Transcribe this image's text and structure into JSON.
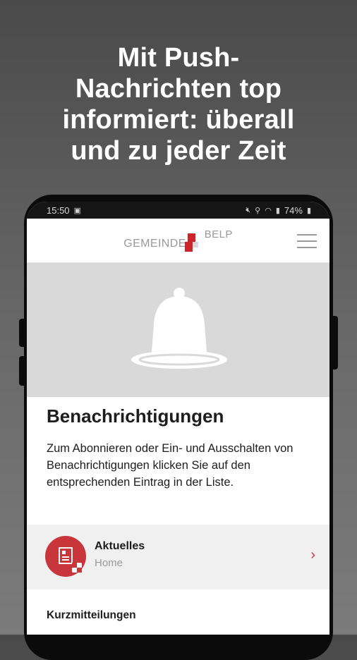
{
  "promo": {
    "line1": "Mit Push-",
    "line2": "Nachrichten top",
    "line3": "informiert: überall",
    "line4": "und zu jeder Zeit"
  },
  "statusbar": {
    "time": "15:50",
    "battery": "74%"
  },
  "app": {
    "logo_left": "GEMEINDE",
    "logo_right": "BELP"
  },
  "page": {
    "title": "Benachrichtigungen",
    "description": "Zum Abonnieren oder Ein- und Ausschalten von Benachrichtigungen klicken Sie auf den entsprechenden Eintrag in der Liste."
  },
  "list": {
    "items": [
      {
        "title": "Aktuelles",
        "subtitle": "Home",
        "icon": "news-icon"
      }
    ],
    "section_title": "Kurzmitteilungen"
  },
  "colors": {
    "accent": "#c8363c",
    "hero_bg": "#d9d9d9",
    "list_bg": "#f0f0f0"
  }
}
